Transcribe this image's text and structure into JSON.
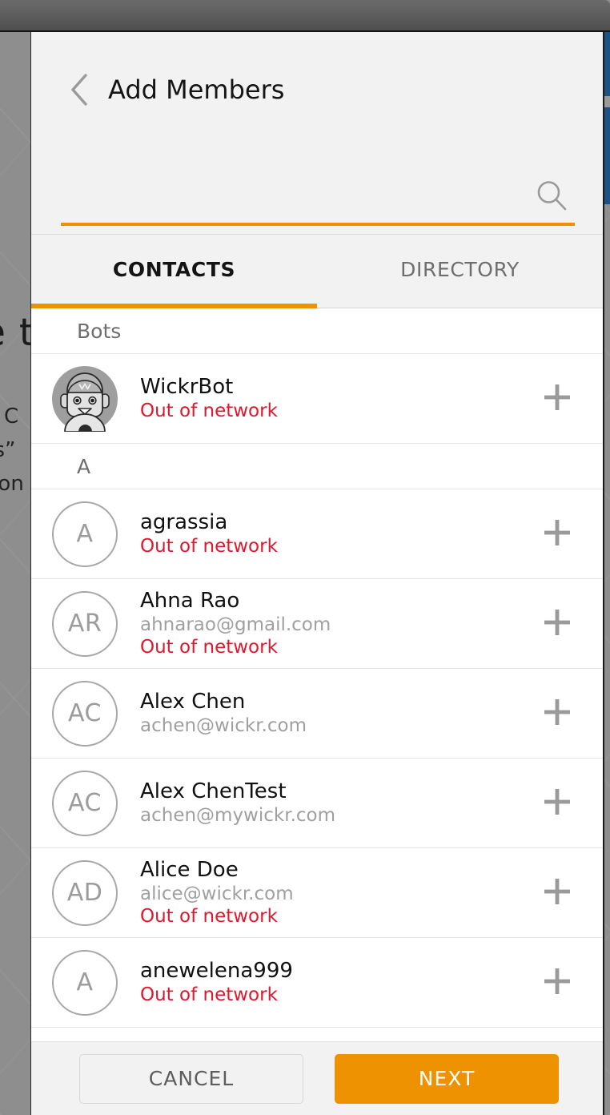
{
  "window": {
    "titlebar_color": "#5c5c5c"
  },
  "backdrop": {
    "overlay_color": "#8e8e8e",
    "accent_blue": "#1c5382",
    "text_big": "e t",
    "text_line1": "r C",
    "text_line2": "ns”",
    "text_line3": "tion"
  },
  "header": {
    "back_icon": "chevron-left-icon",
    "title": "Add Members"
  },
  "search": {
    "value": "",
    "placeholder": "",
    "icon": "search-icon",
    "underline_color": "#ef9201"
  },
  "tabs": {
    "active_index": 0,
    "indicator_color": "#ef9201",
    "items": [
      {
        "label": "CONTACTS",
        "active": true
      },
      {
        "label": "DIRECTORY",
        "active": false
      }
    ]
  },
  "list": {
    "add_icon": "plus-icon",
    "status_color": "#e0182d",
    "sections": [
      {
        "header": "Bots",
        "contacts": [
          {
            "name": "WickrBot",
            "email": "",
            "status": "Out of network",
            "avatar_type": "bot",
            "avatar_initials": "",
            "add_label": "+"
          }
        ]
      },
      {
        "header": "A",
        "contacts": [
          {
            "name": "agrassia",
            "email": "",
            "status": "Out of network",
            "avatar_type": "initials",
            "avatar_initials": "A",
            "add_label": "+"
          },
          {
            "name": "Ahna Rao",
            "email": "ahnarao@gmail.com",
            "status": "Out of network",
            "avatar_type": "initials",
            "avatar_initials": "AR",
            "add_label": "+"
          },
          {
            "name": "Alex Chen",
            "email": "achen@wickr.com",
            "status": "",
            "avatar_type": "initials",
            "avatar_initials": "AC",
            "add_label": "+"
          },
          {
            "name": "Alex ChenTest",
            "email": "achen@mywickr.com",
            "status": "",
            "avatar_type": "initials",
            "avatar_initials": "AC",
            "add_label": "+"
          },
          {
            "name": "Alice Doe",
            "email": "alice@wickr.com",
            "status": "Out of network",
            "avatar_type": "initials",
            "avatar_initials": "AD",
            "add_label": "+"
          },
          {
            "name": "anewelena999",
            "email": "",
            "status": "Out of network",
            "avatar_type": "initials",
            "avatar_initials": "A",
            "add_label": "+"
          }
        ]
      }
    ]
  },
  "footer": {
    "cancel_label": "CANCEL",
    "next_label": "NEXT",
    "next_color": "#ef9201"
  }
}
